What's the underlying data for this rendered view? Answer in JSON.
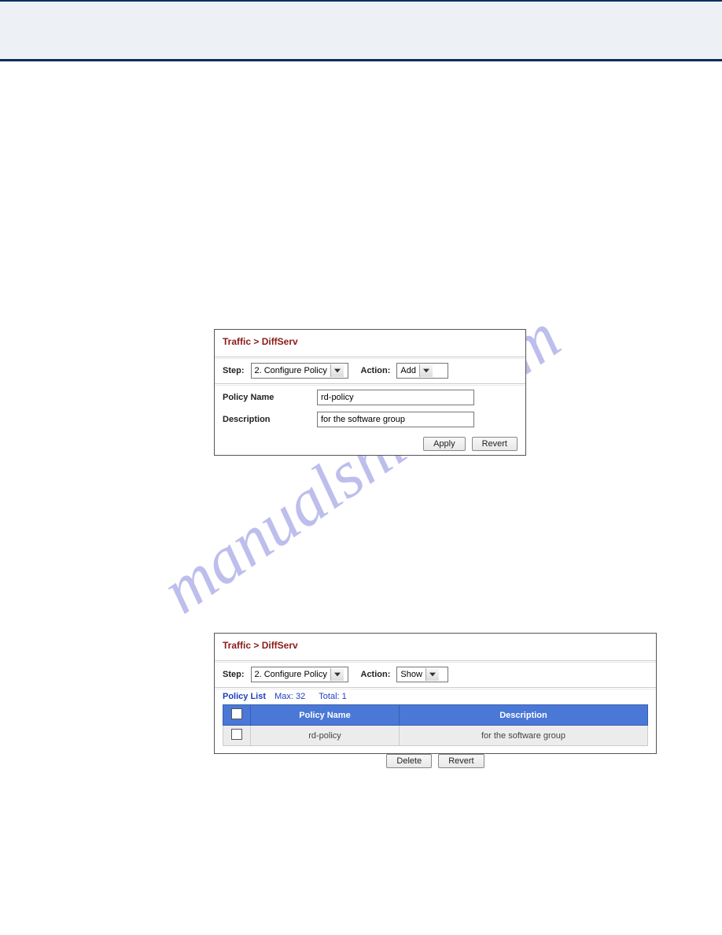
{
  "watermark": "manualshive.com",
  "breadcrumb": "Traffic > DiffServ",
  "labels": {
    "step": "Step:",
    "action": "Action:",
    "policy_name": "Policy Name",
    "description": "Description"
  },
  "panel1": {
    "step_value": "2. Configure Policy",
    "action_value": "Add",
    "policy_name_value": "rd-policy",
    "description_value": "for the software group",
    "apply": "Apply",
    "revert": "Revert"
  },
  "panel2": {
    "step_value": "2. Configure Policy",
    "action_value": "Show",
    "list_title": "Policy List",
    "max_label": "Max: 32",
    "total_label": "Total: 1",
    "col_policy": "Policy Name",
    "col_desc": "Description",
    "row": {
      "policy": "rd-policy",
      "desc": "for the software group"
    },
    "delete": "Delete",
    "revert": "Revert"
  }
}
